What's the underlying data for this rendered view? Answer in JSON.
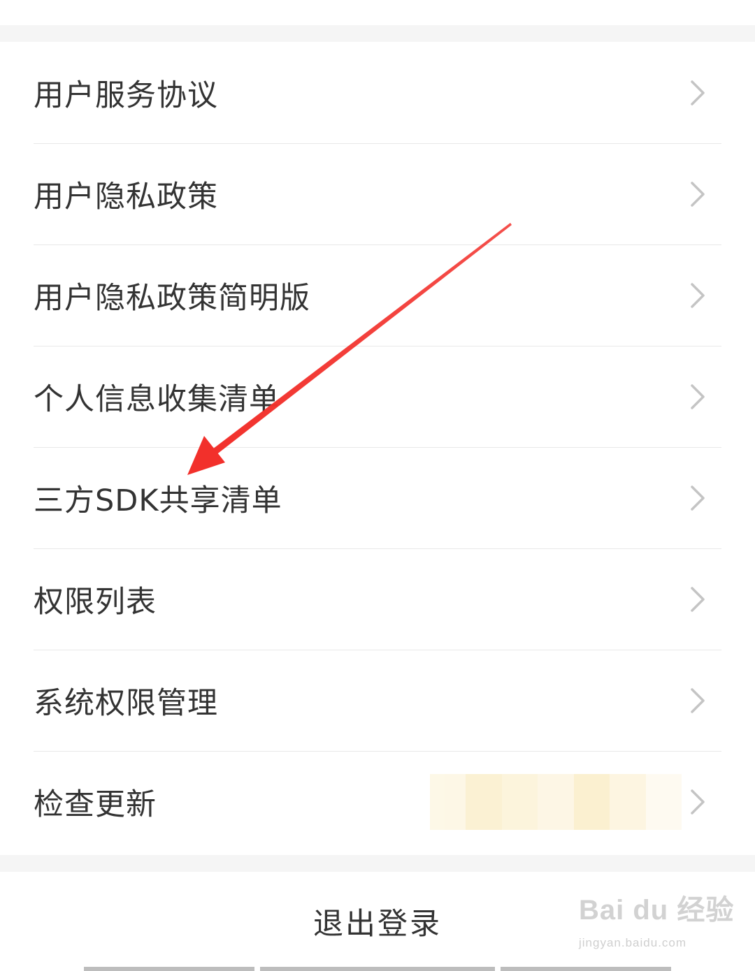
{
  "menu": {
    "items": [
      {
        "label": "用户服务协议"
      },
      {
        "label": "用户隐私政策"
      },
      {
        "label": "用户隐私政策简明版"
      },
      {
        "label": "个人信息收集清单"
      },
      {
        "label": "三方SDK共享清单"
      },
      {
        "label": "权限列表"
      },
      {
        "label": "系统权限管理"
      },
      {
        "label": "检查更新"
      }
    ],
    "chevron_icon": "chevron-right-icon",
    "chevron_color": "#c4c4c4"
  },
  "logout": {
    "label": "退出登录"
  },
  "annotation": {
    "arrow_color": "#f2302b"
  },
  "watermark": {
    "brand": "Bai du 经验",
    "url": "jingyan.baidu.com"
  }
}
